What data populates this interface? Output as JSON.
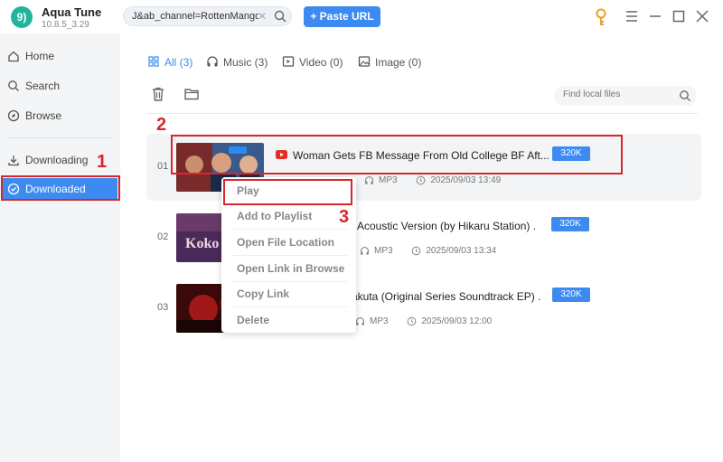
{
  "app": {
    "logo_text": "9)",
    "name": "Aqua Tune",
    "version": "10.8.5_3.29"
  },
  "toolbar": {
    "url_value": "J&ab_channel=RottenMango",
    "paste_label": "+ Paste URL"
  },
  "sidebar": {
    "items": [
      {
        "label": "Home",
        "icon": "home-icon"
      },
      {
        "label": "Search",
        "icon": "search-icon"
      },
      {
        "label": "Browse",
        "icon": "compass-icon"
      },
      {
        "label": "Downloading",
        "icon": "download-icon"
      },
      {
        "label": "Downloaded",
        "icon": "check-circle-icon",
        "active": true
      }
    ]
  },
  "tabs": [
    {
      "label": "All (3)",
      "active": true
    },
    {
      "label": "Music (3)"
    },
    {
      "label": "Video (0)"
    },
    {
      "label": "Image (0)"
    }
  ],
  "find": {
    "placeholder": "Find local files"
  },
  "rows": [
    {
      "num": "01",
      "title": "Woman Gets FB Message From Old College BF Aft...",
      "quality": "320K",
      "format": "MP3",
      "date": "2025/09/03 13:49"
    },
    {
      "num": "02",
      "title": "Acoustic Version (by Hikaru Station) .",
      "quality": "320K",
      "format": "MP3",
      "date": "2025/09/03 13:34"
    },
    {
      "num": "03",
      "title": "akuta (Original Series Soundtrack EP) .",
      "quality": "320K",
      "format": "MP3",
      "date": "2025/09/03 12:00"
    }
  ],
  "context_menu": [
    "Play",
    "Add to Playlist",
    "Open File Location",
    "Open Link in Browse",
    "Copy Link",
    "Delete"
  ],
  "annotations": {
    "step1": "1",
    "step2": "2",
    "step3": "3"
  },
  "colors": {
    "accent": "#3d8bf0",
    "annotation": "#d9262c",
    "logo": "#1fb59c"
  }
}
